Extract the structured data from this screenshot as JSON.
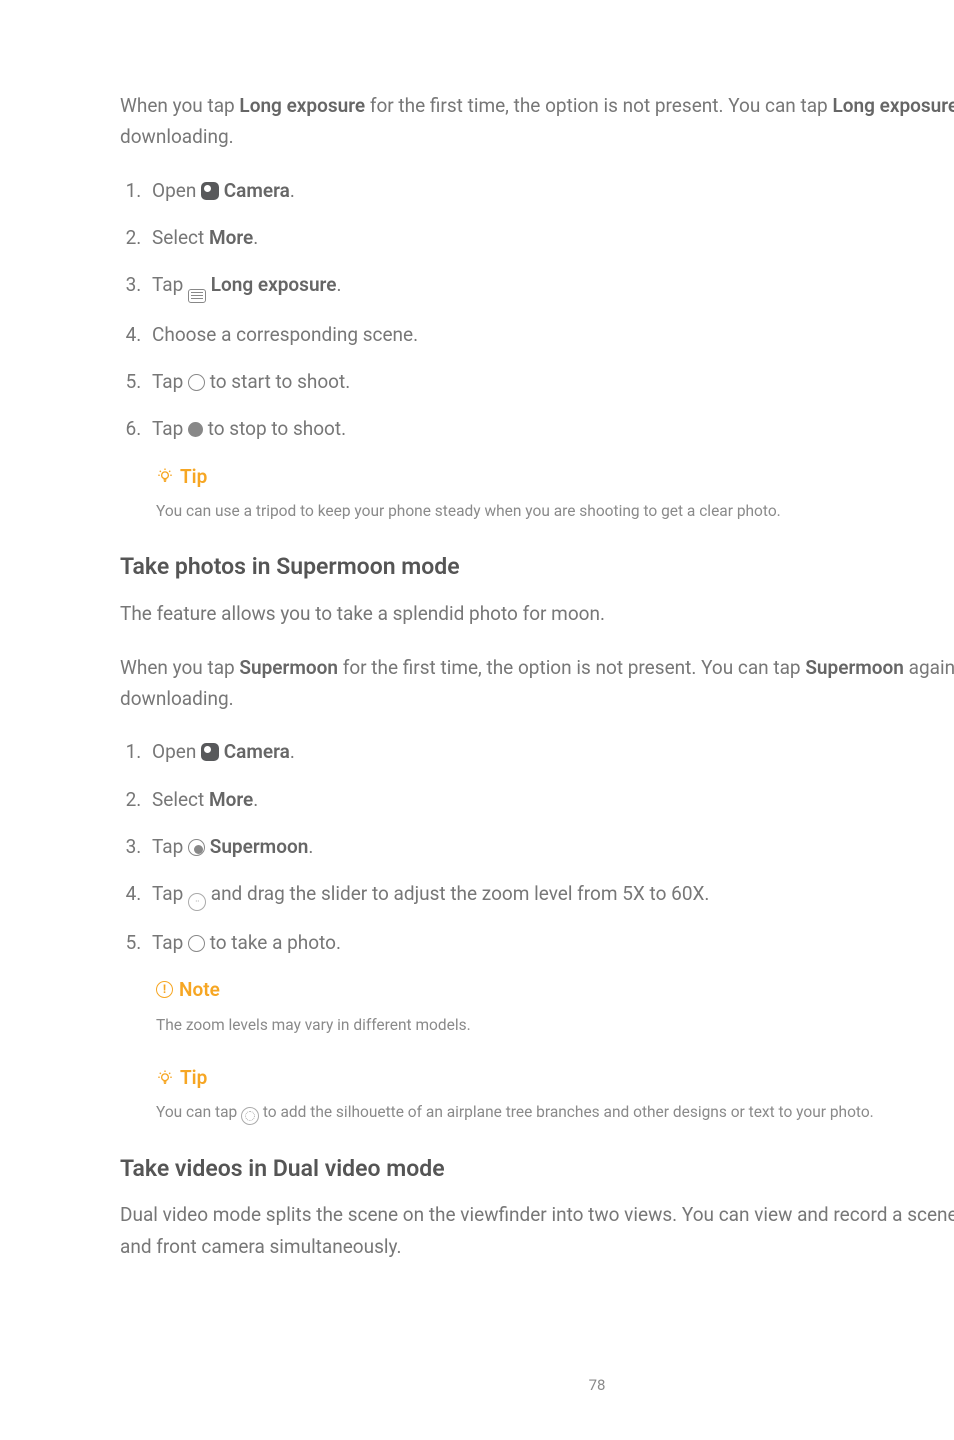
{
  "intro": {
    "p1_a": "When you tap ",
    "p1_bold1": "Long exposure",
    "p1_b": " for the first time, the option is not present. You can tap ",
    "p1_bold2": "Long exposure",
    "p1_c": " again after downloading."
  },
  "steps1": {
    "s1_a": "Open ",
    "s1_bold": "Camera",
    "s1_b": ".",
    "s2_a": "Select ",
    "s2_bold": "More",
    "s2_b": ".",
    "s3_a": "Tap ",
    "s3_bold": "Long exposure",
    "s3_b": ".",
    "s4": "Choose a corresponding scene.",
    "s5_a": "Tap ",
    "s5_b": " to start to shoot.",
    "s6_a": "Tap ",
    "s6_b": " to stop to shoot."
  },
  "tip1": {
    "label": "Tip",
    "body": "You can use a tripod to keep your phone steady when you are shooting to get a clear photo."
  },
  "section2": {
    "heading": "Take photos in Supermoon mode",
    "desc": "The feature allows you to take a splendid photo for moon.",
    "p_a": "When you tap ",
    "p_bold1": "Supermoon",
    "p_b": " for the first time, the option is not present. You can tap ",
    "p_bold2": "Supermoon",
    "p_c": " again after downloading."
  },
  "steps2": {
    "s1_a": "Open ",
    "s1_bold": "Camera",
    "s1_b": ".",
    "s2_a": "Select ",
    "s2_bold": "More",
    "s2_b": ".",
    "s3_a": "Tap ",
    "s3_bold": "Supermoon",
    "s3_b": ".",
    "s4_a": "Tap ",
    "s4_b": " and drag the slider to adjust the zoom level from 5X to 60X.",
    "s5_a": "Tap ",
    "s5_b": " to take a photo."
  },
  "note": {
    "label": "Note",
    "body": "The zoom levels may vary in different models."
  },
  "tip2": {
    "label": "Tip",
    "body_a": "You can tap ",
    "body_b": " to add the silhouette of an airplane tree branches and other designs or text to your photo."
  },
  "section3": {
    "heading": "Take videos in Dual video mode",
    "desc": "Dual video mode splits the scene on the viewfinder into two views. You can view and record a scene with the rear and front camera simultaneously."
  },
  "page": "78"
}
